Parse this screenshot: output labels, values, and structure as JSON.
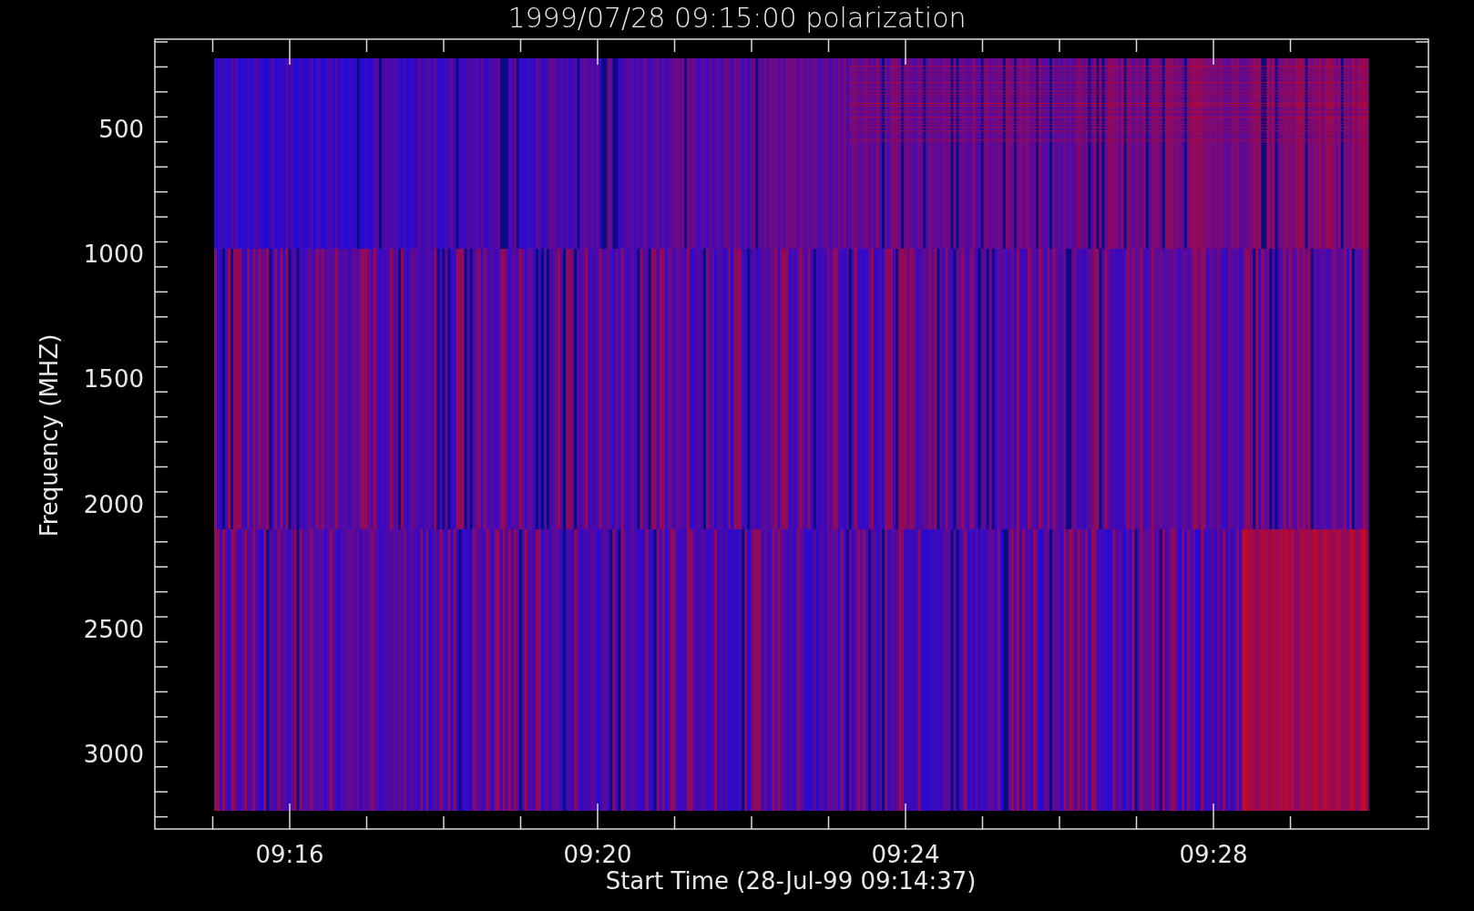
{
  "plot": {
    "title": "1999/07/28 09:15:00 polarization",
    "xlabel": "Start Time (28-Jul-99 09:14:37)",
    "ylabel": "Frequency (MHZ)",
    "xticks": [
      "09:16",
      "09:20",
      "09:24",
      "09:28"
    ],
    "yticks": [
      "500",
      "1000",
      "1500",
      "2000",
      "2500",
      "3000"
    ]
  }
}
